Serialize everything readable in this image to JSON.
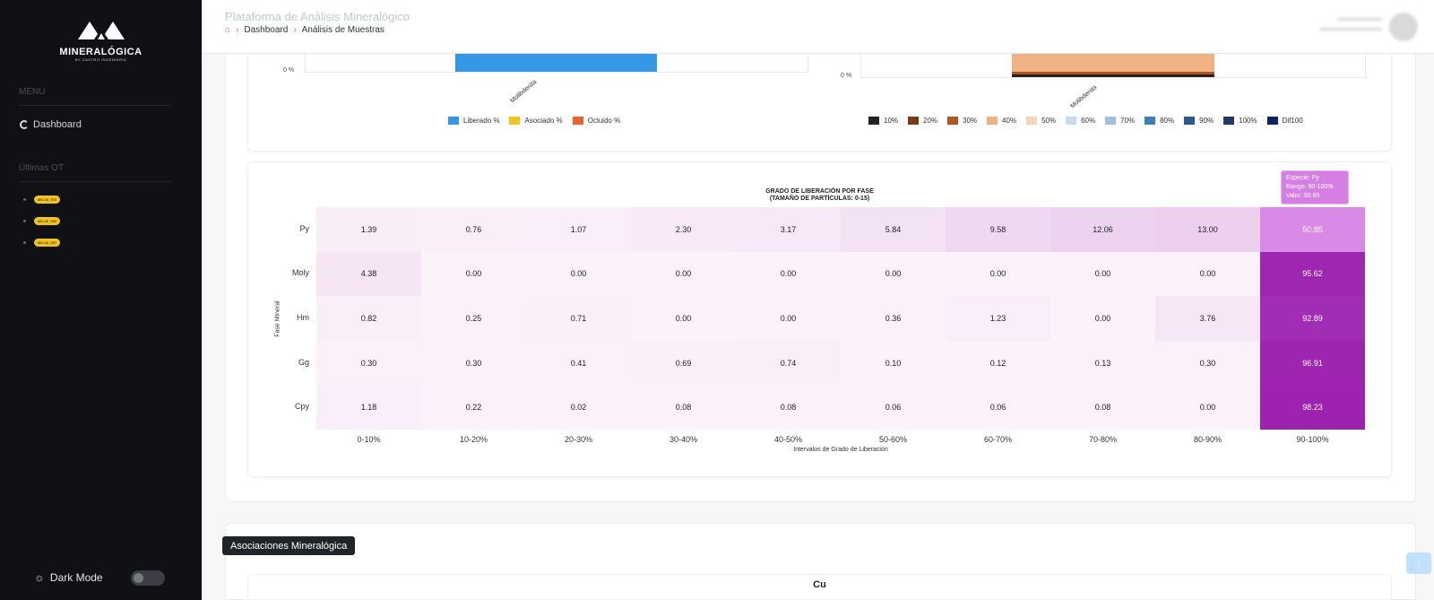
{
  "brand": {
    "name": "MINERALÓGICA",
    "subtitle": "BY CASTRO INGENIERÍA"
  },
  "sidebar": {
    "menu_heading": "MENU",
    "dashboard_label": "Dashboard",
    "recent_heading": "Últimas OT",
    "recent_items": [
      "MO-16_070",
      "MO-16_059",
      "MO-16_057"
    ],
    "dark_mode_label": "Dark Mode"
  },
  "header": {
    "app_title": "Plataforma de Análisis Mineralógico",
    "breadcrumb": [
      "Dashboard",
      "Análisis de Muestras"
    ]
  },
  "top_charts": {
    "left": {
      "y_tick": "0 %",
      "category": "Molibdenita",
      "legend": [
        {
          "label": "Liberado %",
          "color": "#3399e6"
        },
        {
          "label": "Asociado %",
          "color": "#f1c51a"
        },
        {
          "label": "Ocluido %",
          "color": "#f0602c"
        }
      ]
    },
    "right": {
      "y_tick": "0 %",
      "category": "Molibdenita",
      "legend": [
        {
          "label": "10%",
          "color": "#222222"
        },
        {
          "label": "20%",
          "color": "#7a3b12"
        },
        {
          "label": "30%",
          "color": "#b4561c"
        },
        {
          "label": "40%",
          "color": "#f0b283"
        },
        {
          "label": "50%",
          "color": "#f7d3b7"
        },
        {
          "label": "60%",
          "color": "#c7daf0"
        },
        {
          "label": "70%",
          "color": "#9cc1e3"
        },
        {
          "label": "80%",
          "color": "#3b7fc0"
        },
        {
          "label": "90%",
          "color": "#2a5b90"
        },
        {
          "label": "100%",
          "color": "#1f3a6b"
        },
        {
          "label": "Dif100",
          "color": "#0d2463"
        }
      ]
    }
  },
  "chart_data": {
    "type": "heatmap",
    "title": "GRADO DE LIBERACIÓN POR FASE",
    "subtitle": "(TAMAÑO DE PARTÍCULAS: 0-15)",
    "xlabel": "Intervalos de Grado de Liberación",
    "ylabel": "Fase Mineral",
    "x": [
      "0-10%",
      "10-20%",
      "20-30%",
      "30-40%",
      "40-50%",
      "50-60%",
      "60-70%",
      "70-80%",
      "80-90%",
      "90-100%"
    ],
    "y": [
      "Py",
      "Moly",
      "Hm",
      "Gg",
      "Cpy"
    ],
    "values": [
      [
        1.39,
        0.76,
        1.07,
        2.3,
        3.17,
        5.84,
        9.58,
        12.06,
        13.0,
        50.85
      ],
      [
        4.38,
        0.0,
        0.0,
        0.0,
        0.0,
        0.0,
        0.0,
        0.0,
        0.0,
        95.62
      ],
      [
        0.82,
        0.25,
        0.71,
        0.0,
        0.0,
        0.36,
        1.23,
        0.0,
        3.76,
        92.89
      ],
      [
        0.3,
        0.3,
        0.41,
        0.69,
        0.74,
        0.1,
        0.12,
        0.13,
        0.3,
        96.91
      ],
      [
        1.18,
        0.22,
        0.02,
        0.08,
        0.08,
        0.06,
        0.06,
        0.08,
        0.0,
        98.23
      ]
    ],
    "tooltip": {
      "especie": "Especie: Py",
      "rango": "Rango: 90-100%",
      "valor": "Valor: 50.85"
    }
  },
  "associations": {
    "tab_label": "Asociaciones Mineralógica",
    "chart_title": "Cu"
  }
}
